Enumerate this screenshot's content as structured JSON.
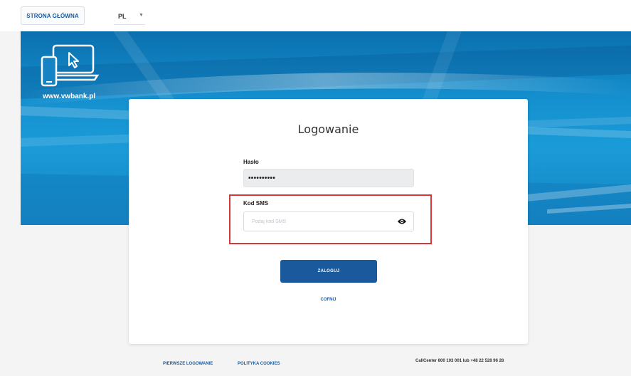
{
  "topbar": {
    "home_label": "STRONA GŁÓWNA",
    "language": "PL"
  },
  "banner": {
    "site_url": "www.vwbank.pl"
  },
  "login": {
    "title": "Logowanie",
    "password_label": "Hasło",
    "password_value": "••••••••••",
    "sms_label": "Kod SMS",
    "sms_placeholder": "Podaj kod SMS",
    "submit_label": "ZALOGUJ",
    "back_label": "COFNIJ"
  },
  "footer": {
    "first_login": "PIERWSZE LOGOWANIE",
    "cookies": "POLITYKA COOKIES",
    "callcenter": "CallCenter 800 103 001 lub +48 22 528 96 28"
  },
  "colors": {
    "brand_blue": "#1a5a9c",
    "banner_blue": "#1a9bd8",
    "highlight_red": "#d9383a"
  },
  "icons": {
    "language_caret": "chevron-down-icon",
    "devices_logo": "devices-icon",
    "password_reveal": "eye-icon"
  }
}
